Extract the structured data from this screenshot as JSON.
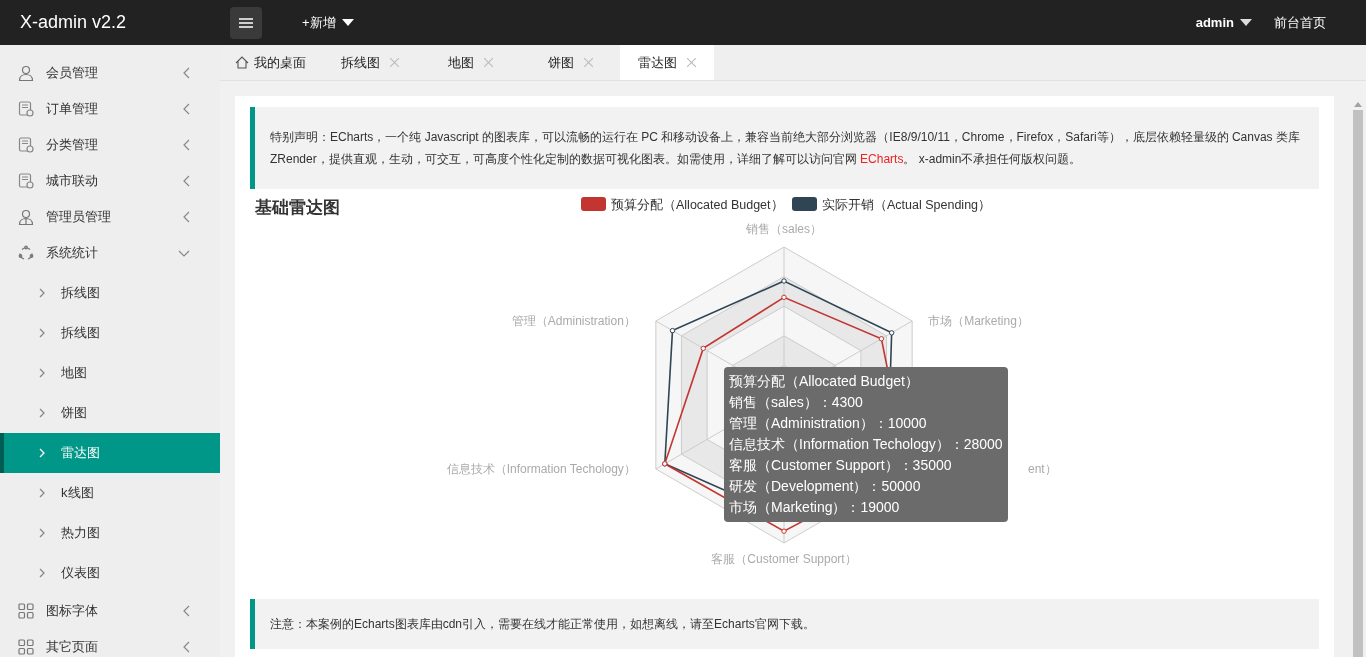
{
  "header": {
    "logo": "X-admin v2.2",
    "add_menu": "+新增",
    "user": "admin",
    "front_link": "前台首页"
  },
  "sidebar": {
    "items": [
      {
        "label": "会员管理",
        "expanded": false
      },
      {
        "label": "订单管理",
        "expanded": false
      },
      {
        "label": "分类管理",
        "expanded": false
      },
      {
        "label": "城市联动",
        "expanded": false
      },
      {
        "label": "管理员管理",
        "expanded": false
      },
      {
        "label": "系统统计",
        "expanded": true,
        "children": [
          {
            "label": "拆线图",
            "selected": false
          },
          {
            "label": "拆线图",
            "selected": false
          },
          {
            "label": "地图",
            "selected": false
          },
          {
            "label": "饼图",
            "selected": false
          },
          {
            "label": "雷达图",
            "selected": true
          },
          {
            "label": "k线图",
            "selected": false
          },
          {
            "label": "热力图",
            "selected": false
          },
          {
            "label": "仪表图",
            "selected": false
          }
        ]
      },
      {
        "label": "图标字体",
        "expanded": false
      },
      {
        "label": "其它页面",
        "expanded": false
      }
    ]
  },
  "tabs": [
    {
      "kind": "home",
      "label": "我的桌面",
      "selected": false
    },
    {
      "kind": "page",
      "label": "拆线图",
      "selected": false
    },
    {
      "kind": "page",
      "label": "地图",
      "selected": false
    },
    {
      "kind": "page",
      "label": "饼图",
      "selected": false
    },
    {
      "kind": "page",
      "label": "雷达图",
      "selected": true
    }
  ],
  "notice": {
    "text": "特别声明：ECharts，一个纯 Javascript 的图表库，可以流畅的运行在 PC 和移动设备上，兼容当前绝大部分浏览器（IE8/9/10/11，Chrome，Firefox，Safari等），底层依赖轻量级的 Canvas 类库 ZRender，提供直观，生动，可交互，可高度个性化定制的数据可视化图表。如需使用，详细了解可以访问官网 ",
    "link": "ECharts",
    "text_after": "。 x-admin不承担任何版权问题。"
  },
  "chart": {
    "title": "基础雷达图",
    "radar": {
      "axis_labels": [
        "销售（sales）",
        "管理（Administration）",
        "市场（Marketing）",
        "信息技术（Information Techology）",
        "ent）",
        "客服（Customer Support）"
      ],
      "legend": [
        {
          "name": "预算分配（Allocated Budget）",
          "color": "#c23531"
        },
        {
          "name": "实际开销（Actual Spending）",
          "color": "#2f4554"
        }
      ]
    },
    "tooltip": {
      "title": "预算分配（Allocated Budget）",
      "lines": [
        "销售（sales）：4300",
        "管理（Administration）：10000",
        "信息技术（Information Techology）：28000",
        "客服（Customer Support）：35000",
        "研发（Development）：50000",
        "市场（Marketing）：19000"
      ]
    }
  },
  "note": "注意：本案例的Echarts图表库由cdn引入，需要在线才能正常使用，如想离线，请至Echarts官网下载。"
}
